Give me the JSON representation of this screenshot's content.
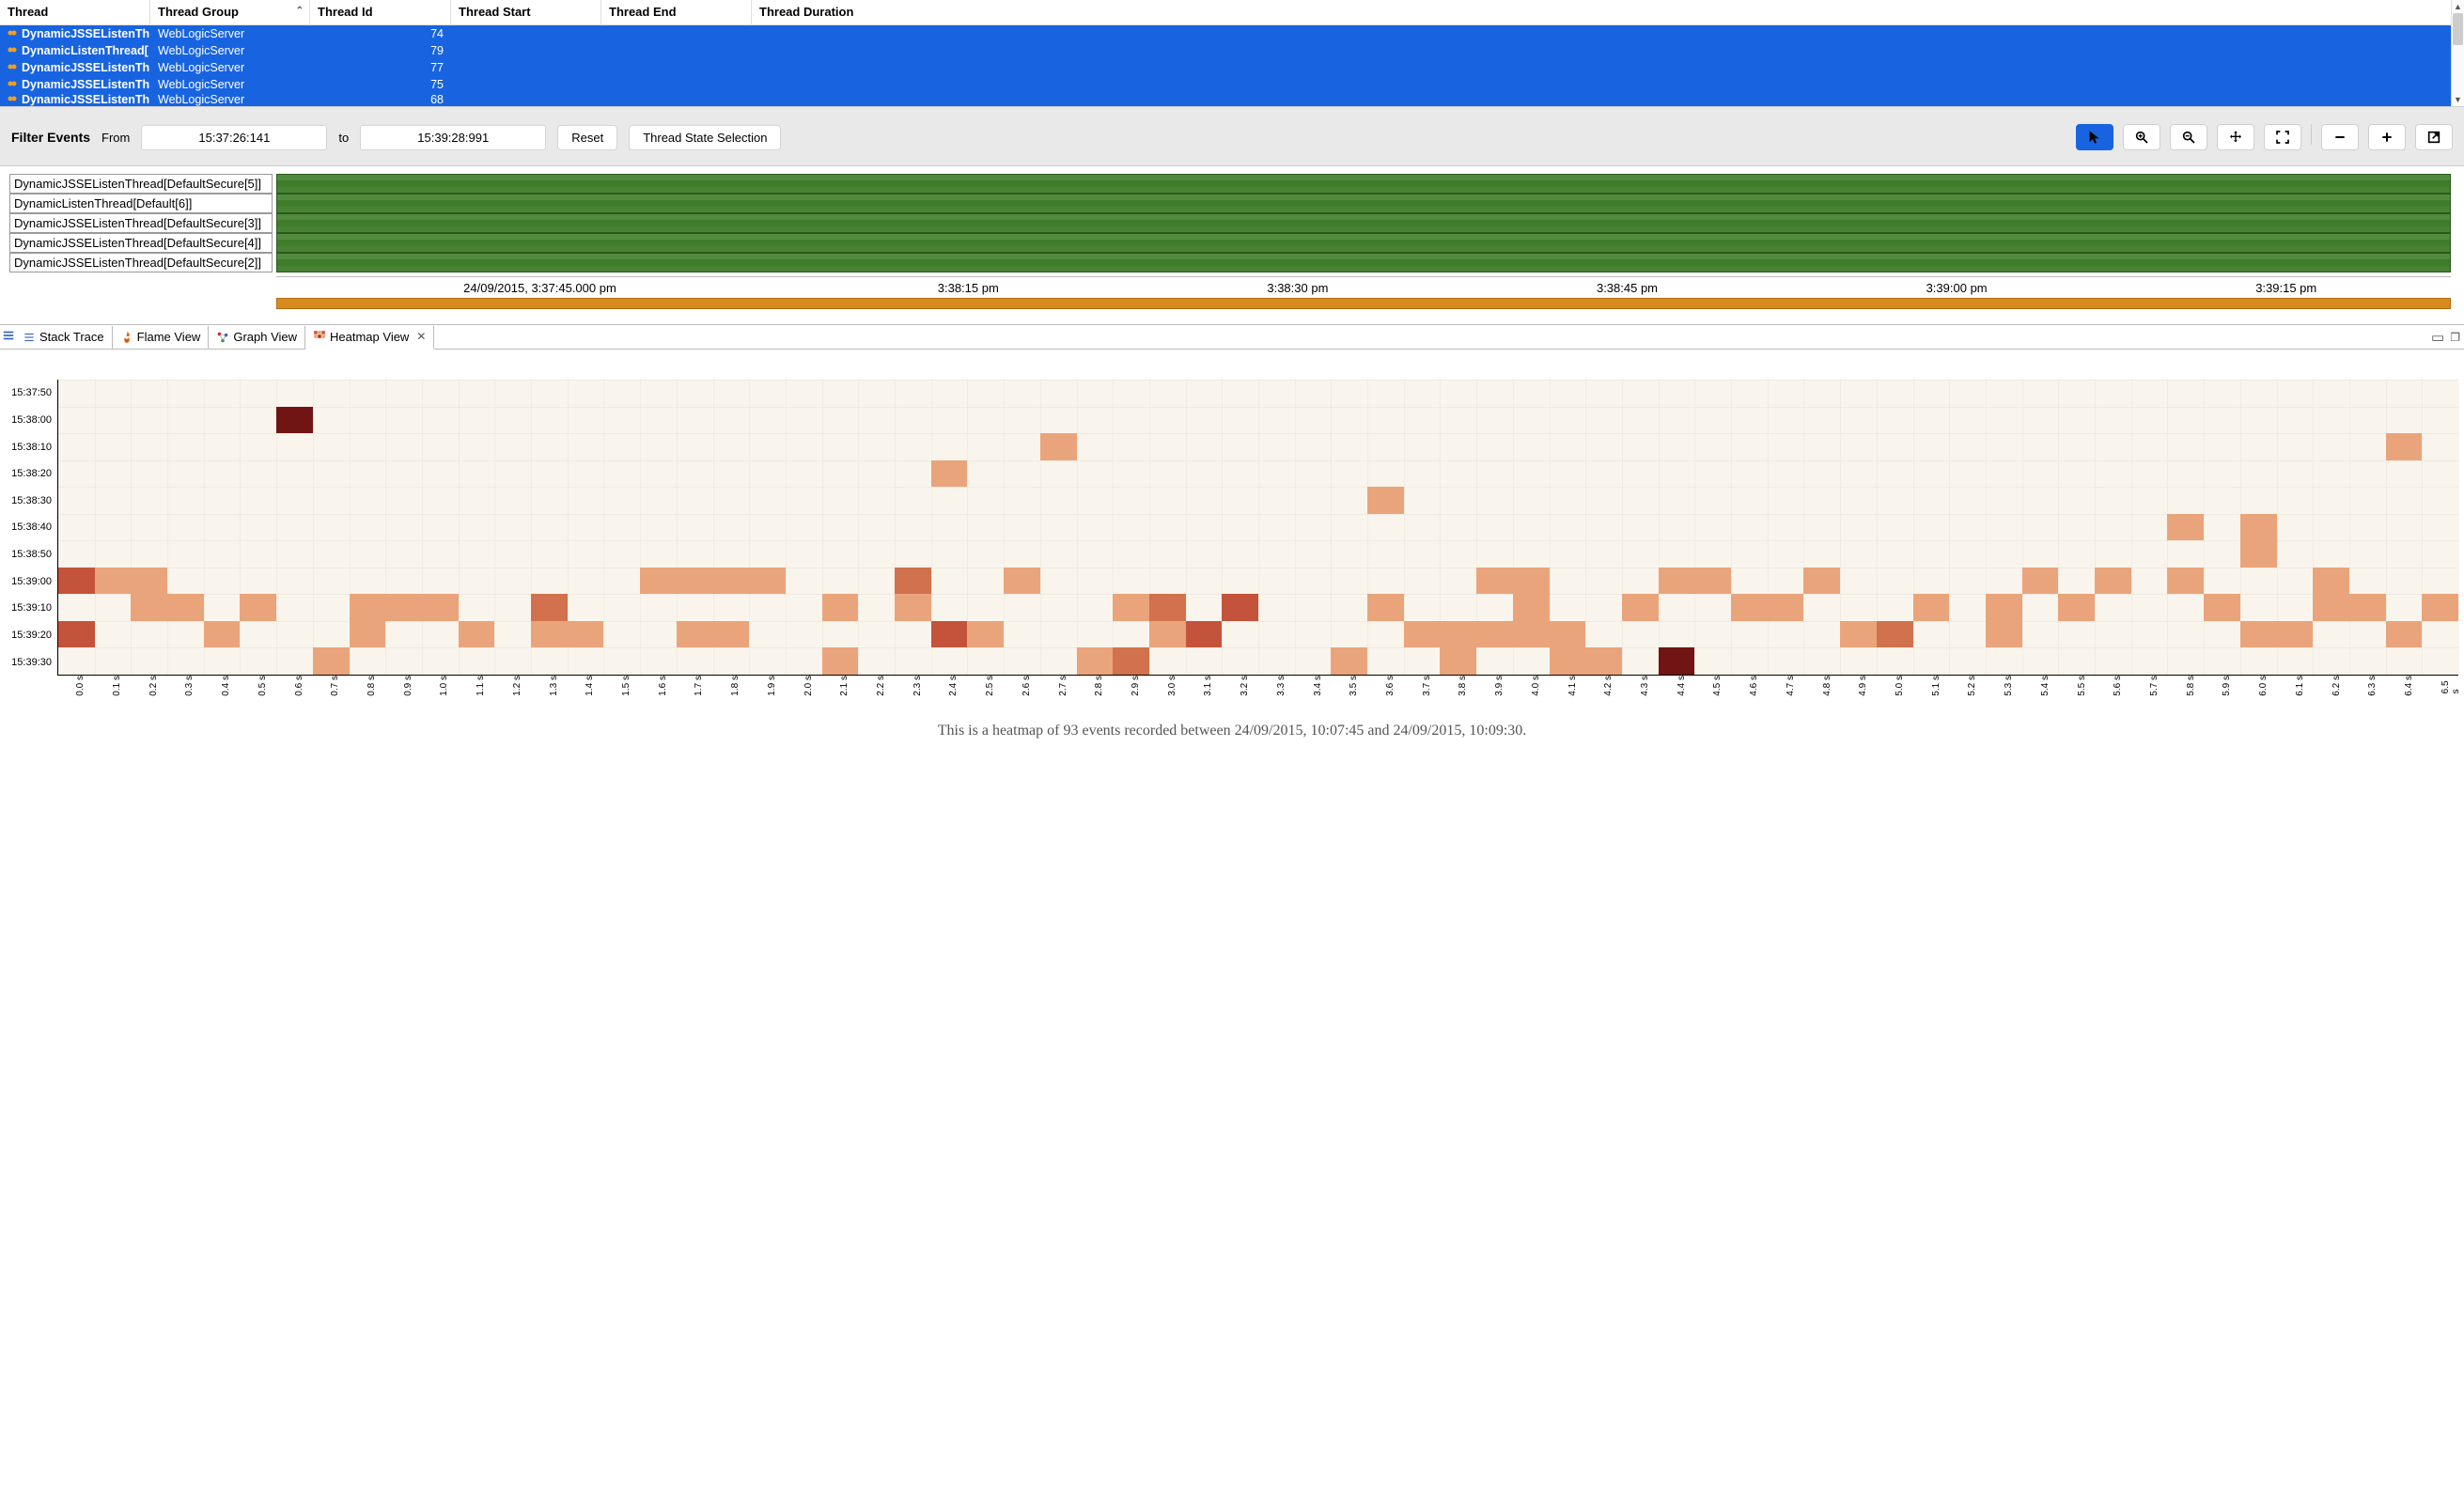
{
  "table": {
    "columns": [
      {
        "label": "Thread",
        "width": 160
      },
      {
        "label": "Thread Group",
        "width": 170,
        "sorted": true
      },
      {
        "label": "Thread Id",
        "width": 150
      },
      {
        "label": "Thread Start",
        "width": 160
      },
      {
        "label": "Thread End",
        "width": 160
      },
      {
        "label": "Thread Duration",
        "width": 160
      }
    ],
    "rows": [
      {
        "thread": "DynamicJSSEListenThr",
        "group": "WebLogicServer",
        "id": "74"
      },
      {
        "thread": "DynamicListenThread[",
        "group": "WebLogicServer",
        "id": "79"
      },
      {
        "thread": "DynamicJSSEListenThr",
        "group": "WebLogicServer",
        "id": "77"
      },
      {
        "thread": "DynamicJSSEListenThr",
        "group": "WebLogicServer",
        "id": "75"
      },
      {
        "thread": "DynamicJSSEListenThr",
        "group": "WebLogicServer",
        "id": "68"
      }
    ]
  },
  "toolbar": {
    "filter_label": "Filter Events",
    "from_label": "From",
    "from_value": "15:37:26:141",
    "to_label": "to",
    "to_value": "15:39:28:991",
    "reset_label": "Reset",
    "selection_label": "Thread State Selection"
  },
  "timeline": {
    "rows": [
      "DynamicJSSEListenThread[DefaultSecure[5]]",
      "DynamicListenThread[Default[6]]",
      "DynamicJSSEListenThread[DefaultSecure[3]]",
      "DynamicJSSEListenThread[DefaultSecure[4]]",
      "DynamicJSSEListenThread[DefaultSecure[2]]"
    ],
    "ticks": [
      "24/09/2015, 3:37:45.000 pm",
      "3:38:15 pm",
      "3:38:30 pm",
      "3:38:45 pm",
      "3:39:00 pm",
      "3:39:15 pm"
    ]
  },
  "tabs": {
    "items": [
      {
        "label": "Stack Trace",
        "icon": "list"
      },
      {
        "label": "Flame View",
        "icon": "flame"
      },
      {
        "label": "Graph View",
        "icon": "graph"
      },
      {
        "label": "Heatmap View",
        "icon": "heatmap",
        "active": true,
        "closable": true
      }
    ]
  },
  "heatmap": {
    "caption": "This is a heatmap of 93 events recorded between 24/09/2015, 10:07:45 and 24/09/2015, 10:09:30.",
    "chart_data": {
      "type": "heatmap",
      "xlabel": "",
      "ylabel": "",
      "y_categories": [
        "15:37:50",
        "15:38:00",
        "15:38:10",
        "15:38:20",
        "15:38:30",
        "15:38:40",
        "15:38:50",
        "15:39:00",
        "15:39:10",
        "15:39:20",
        "15:39:30"
      ],
      "x_categories": [
        "0.0 s",
        "0.1 s",
        "0.2 s",
        "0.3 s",
        "0.4 s",
        "0.5 s",
        "0.6 s",
        "0.7 s",
        "0.8 s",
        "0.9 s",
        "1.0 s",
        "1.1 s",
        "1.2 s",
        "1.3 s",
        "1.4 s",
        "1.5 s",
        "1.6 s",
        "1.7 s",
        "1.8 s",
        "1.9 s",
        "2.0 s",
        "2.1 s",
        "2.2 s",
        "2.3 s",
        "2.4 s",
        "2.5 s",
        "2.6 s",
        "2.7 s",
        "2.8 s",
        "2.9 s",
        "3.0 s",
        "3.1 s",
        "3.2 s",
        "3.3 s",
        "3.4 s",
        "3.5 s",
        "3.6 s",
        "3.7 s",
        "3.8 s",
        "3.9 s",
        "4.0 s",
        "4.1 s",
        "4.2 s",
        "4.3 s",
        "4.4 s",
        "4.5 s",
        "4.6 s",
        "4.7 s",
        "4.8 s",
        "4.9 s",
        "5.0 s",
        "5.1 s",
        "5.2 s",
        "5.3 s",
        "5.4 s",
        "5.5 s",
        "5.6 s",
        "5.7 s",
        "5.8 s",
        "5.9 s",
        "6.0 s",
        "6.1 s",
        "6.2 s",
        "6.3 s",
        "6.4 s",
        "6.5 s"
      ],
      "legend_scale": "count (1=light, 4=dark)",
      "cells": [
        {
          "y": "15:38:00",
          "x": "0.6 s",
          "v": 4
        },
        {
          "y": "15:38:10",
          "x": "2.7 s",
          "v": 1
        },
        {
          "y": "15:38:10",
          "x": "6.4 s",
          "v": 1
        },
        {
          "y": "15:38:20",
          "x": "2.4 s",
          "v": 1
        },
        {
          "y": "15:38:30",
          "x": "3.6 s",
          "v": 1
        },
        {
          "y": "15:38:40",
          "x": "5.8 s",
          "v": 1
        },
        {
          "y": "15:38:40",
          "x": "6.0 s",
          "v": 1
        },
        {
          "y": "15:38:50",
          "x": "6.0 s",
          "v": 1
        },
        {
          "y": "15:39:00",
          "x": "0.0 s",
          "v": 3
        },
        {
          "y": "15:39:00",
          "x": "0.1 s",
          "v": 1
        },
        {
          "y": "15:39:00",
          "x": "0.2 s",
          "v": 1
        },
        {
          "y": "15:39:00",
          "x": "1.6 s",
          "v": 1
        },
        {
          "y": "15:39:00",
          "x": "1.7 s",
          "v": 1
        },
        {
          "y": "15:39:00",
          "x": "1.8 s",
          "v": 1
        },
        {
          "y": "15:39:00",
          "x": "1.9 s",
          "v": 1
        },
        {
          "y": "15:39:00",
          "x": "2.3 s",
          "v": 2
        },
        {
          "y": "15:39:00",
          "x": "2.6 s",
          "v": 1
        },
        {
          "y": "15:39:00",
          "x": "3.9 s",
          "v": 1
        },
        {
          "y": "15:39:00",
          "x": "4.0 s",
          "v": 1
        },
        {
          "y": "15:39:00",
          "x": "4.4 s",
          "v": 1
        },
        {
          "y": "15:39:00",
          "x": "4.5 s",
          "v": 1
        },
        {
          "y": "15:39:00",
          "x": "4.8 s",
          "v": 1
        },
        {
          "y": "15:39:00",
          "x": "5.4 s",
          "v": 1
        },
        {
          "y": "15:39:00",
          "x": "5.6 s",
          "v": 1
        },
        {
          "y": "15:39:00",
          "x": "5.8 s",
          "v": 1
        },
        {
          "y": "15:39:00",
          "x": "6.2 s",
          "v": 1
        },
        {
          "y": "15:39:10",
          "x": "0.2 s",
          "v": 1
        },
        {
          "y": "15:39:10",
          "x": "0.3 s",
          "v": 1
        },
        {
          "y": "15:39:10",
          "x": "0.5 s",
          "v": 1
        },
        {
          "y": "15:39:10",
          "x": "0.8 s",
          "v": 1
        },
        {
          "y": "15:39:10",
          "x": "0.9 s",
          "v": 1
        },
        {
          "y": "15:39:10",
          "x": "1.0 s",
          "v": 1
        },
        {
          "y": "15:39:10",
          "x": "1.3 s",
          "v": 2
        },
        {
          "y": "15:39:10",
          "x": "2.1 s",
          "v": 1
        },
        {
          "y": "15:39:10",
          "x": "2.3 s",
          "v": 1
        },
        {
          "y": "15:39:10",
          "x": "2.9 s",
          "v": 1
        },
        {
          "y": "15:39:10",
          "x": "3.0 s",
          "v": 2
        },
        {
          "y": "15:39:10",
          "x": "3.2 s",
          "v": 3
        },
        {
          "y": "15:39:10",
          "x": "3.6 s",
          "v": 1
        },
        {
          "y": "15:39:10",
          "x": "4.0 s",
          "v": 1
        },
        {
          "y": "15:39:10",
          "x": "4.3 s",
          "v": 1
        },
        {
          "y": "15:39:10",
          "x": "4.6 s",
          "v": 1
        },
        {
          "y": "15:39:10",
          "x": "4.7 s",
          "v": 1
        },
        {
          "y": "15:39:10",
          "x": "5.1 s",
          "v": 1
        },
        {
          "y": "15:39:10",
          "x": "5.3 s",
          "v": 1
        },
        {
          "y": "15:39:10",
          "x": "5.5 s",
          "v": 1
        },
        {
          "y": "15:39:10",
          "x": "5.9 s",
          "v": 1
        },
        {
          "y": "15:39:10",
          "x": "6.2 s",
          "v": 1
        },
        {
          "y": "15:39:10",
          "x": "6.3 s",
          "v": 1
        },
        {
          "y": "15:39:10",
          "x": "6.5 s",
          "v": 1
        },
        {
          "y": "15:39:20",
          "x": "0.0 s",
          "v": 3
        },
        {
          "y": "15:39:20",
          "x": "0.4 s",
          "v": 1
        },
        {
          "y": "15:39:20",
          "x": "0.8 s",
          "v": 1
        },
        {
          "y": "15:39:20",
          "x": "1.1 s",
          "v": 1
        },
        {
          "y": "15:39:20",
          "x": "1.3 s",
          "v": 1
        },
        {
          "y": "15:39:20",
          "x": "1.4 s",
          "v": 1
        },
        {
          "y": "15:39:20",
          "x": "1.7 s",
          "v": 1
        },
        {
          "y": "15:39:20",
          "x": "1.8 s",
          "v": 1
        },
        {
          "y": "15:39:20",
          "x": "2.4 s",
          "v": 3
        },
        {
          "y": "15:39:20",
          "x": "2.5 s",
          "v": 1
        },
        {
          "y": "15:39:20",
          "x": "3.0 s",
          "v": 1
        },
        {
          "y": "15:39:20",
          "x": "3.1 s",
          "v": 3
        },
        {
          "y": "15:39:20",
          "x": "3.7 s",
          "v": 1
        },
        {
          "y": "15:39:20",
          "x": "3.8 s",
          "v": 1
        },
        {
          "y": "15:39:20",
          "x": "3.9 s",
          "v": 1
        },
        {
          "y": "15:39:20",
          "x": "4.0 s",
          "v": 1
        },
        {
          "y": "15:39:20",
          "x": "4.1 s",
          "v": 1
        },
        {
          "y": "15:39:20",
          "x": "4.9 s",
          "v": 1
        },
        {
          "y": "15:39:20",
          "x": "5.0 s",
          "v": 2
        },
        {
          "y": "15:39:20",
          "x": "5.3 s",
          "v": 1
        },
        {
          "y": "15:39:20",
          "x": "6.0 s",
          "v": 1
        },
        {
          "y": "15:39:20",
          "x": "6.1 s",
          "v": 1
        },
        {
          "y": "15:39:20",
          "x": "6.4 s",
          "v": 1
        },
        {
          "y": "15:39:30",
          "x": "0.7 s",
          "v": 1
        },
        {
          "y": "15:39:30",
          "x": "2.1 s",
          "v": 1
        },
        {
          "y": "15:39:30",
          "x": "2.8 s",
          "v": 1
        },
        {
          "y": "15:39:30",
          "x": "2.9 s",
          "v": 2
        },
        {
          "y": "15:39:30",
          "x": "3.5 s",
          "v": 1
        },
        {
          "y": "15:39:30",
          "x": "3.8 s",
          "v": 1
        },
        {
          "y": "15:39:30",
          "x": "4.1 s",
          "v": 1
        },
        {
          "y": "15:39:30",
          "x": "4.2 s",
          "v": 1
        },
        {
          "y": "15:39:30",
          "x": "4.4 s",
          "v": 4
        }
      ]
    }
  }
}
